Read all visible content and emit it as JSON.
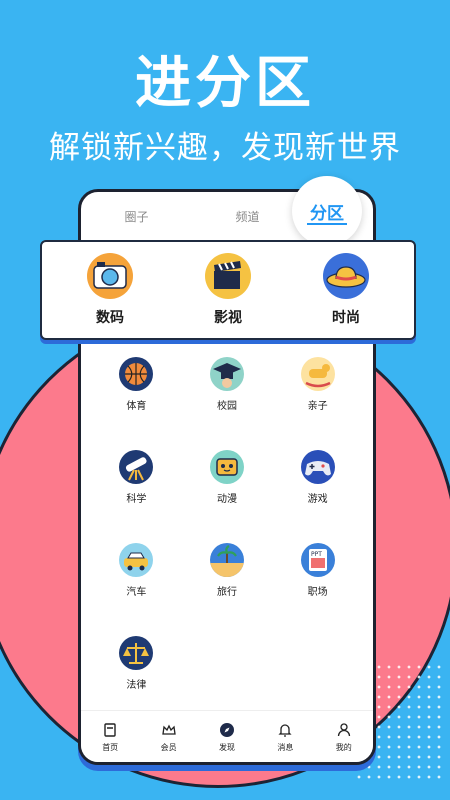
{
  "hero": {
    "title": "进分区",
    "subtitle": "解锁新兴趣，发现新世界"
  },
  "tabs": [
    {
      "label": "圈子"
    },
    {
      "label": "频道"
    },
    {
      "label": "分区",
      "active": true
    }
  ],
  "featured": [
    {
      "label": "数码",
      "icon": "camera-icon"
    },
    {
      "label": "影视",
      "icon": "clapperboard-icon"
    },
    {
      "label": "时尚",
      "icon": "sunhat-icon"
    }
  ],
  "categories": [
    {
      "label": "体育",
      "icon": "basketball-icon"
    },
    {
      "label": "校园",
      "icon": "graduation-cap-icon"
    },
    {
      "label": "亲子",
      "icon": "rocking-horse-icon"
    },
    {
      "label": "科学",
      "icon": "telescope-icon"
    },
    {
      "label": "动漫",
      "icon": "anime-tv-icon"
    },
    {
      "label": "游戏",
      "icon": "gamepad-icon"
    },
    {
      "label": "汽车",
      "icon": "car-icon"
    },
    {
      "label": "旅行",
      "icon": "beach-icon"
    },
    {
      "label": "职场",
      "icon": "ppt-icon"
    },
    {
      "label": "法律",
      "icon": "scales-icon"
    }
  ],
  "bottom_nav": [
    {
      "label": "首页",
      "icon": "home-doc-icon"
    },
    {
      "label": "会员",
      "icon": "crown-icon"
    },
    {
      "label": "发现",
      "icon": "compass-icon"
    },
    {
      "label": "消息",
      "icon": "bell-icon"
    },
    {
      "label": "我的",
      "icon": "user-icon"
    }
  ],
  "colors": {
    "background": "#3ab4f2",
    "accent": "#2196f3",
    "circle": "#fc7a8c"
  }
}
